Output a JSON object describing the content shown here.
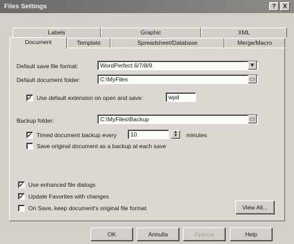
{
  "window": {
    "title": "Files Settings",
    "help_btn": "?",
    "close_btn": "X"
  },
  "tabs_back": [
    "Labels",
    "Graphic",
    "XML"
  ],
  "tabs_front": [
    "Document",
    "Template",
    "Spreadsheet/Database",
    "Merge/Macro"
  ],
  "form": {
    "default_save_label": "Default save file format:",
    "default_save_value": "WordPerfect 6/7/8/9",
    "default_folder_label": "Default document folder:",
    "default_folder_value": "C:\\MyFiles",
    "use_ext_label": "Use default extension on open and save:",
    "use_ext_checked": true,
    "ext_value": "wpd",
    "backup_label": "Backup folder:",
    "backup_value": "C:\\MyFiles\\Backup",
    "timed_label": "Timed document backup every",
    "timed_checked": true,
    "timed_value": "10",
    "minutes_label": "minutes",
    "save_original_label": "Save original document as a backup at each save",
    "save_original_checked": false,
    "enhanced_label": "Use enhanced file dialogs",
    "enhanced_checked": true,
    "favorites_label": "Update Favorites with changes",
    "favorites_checked": true,
    "keep_format_label": "On Save, keep document's original file format",
    "keep_format_checked": false,
    "view_all_label": "View All..."
  },
  "buttons": {
    "ok": "OK",
    "cancel": "Annulla",
    "apply": "Applica",
    "help": "Help"
  },
  "icons": {
    "dropdown": "chevron-down-icon",
    "folder": "folder-browse-icon",
    "spin": "spin-updown-icon"
  }
}
